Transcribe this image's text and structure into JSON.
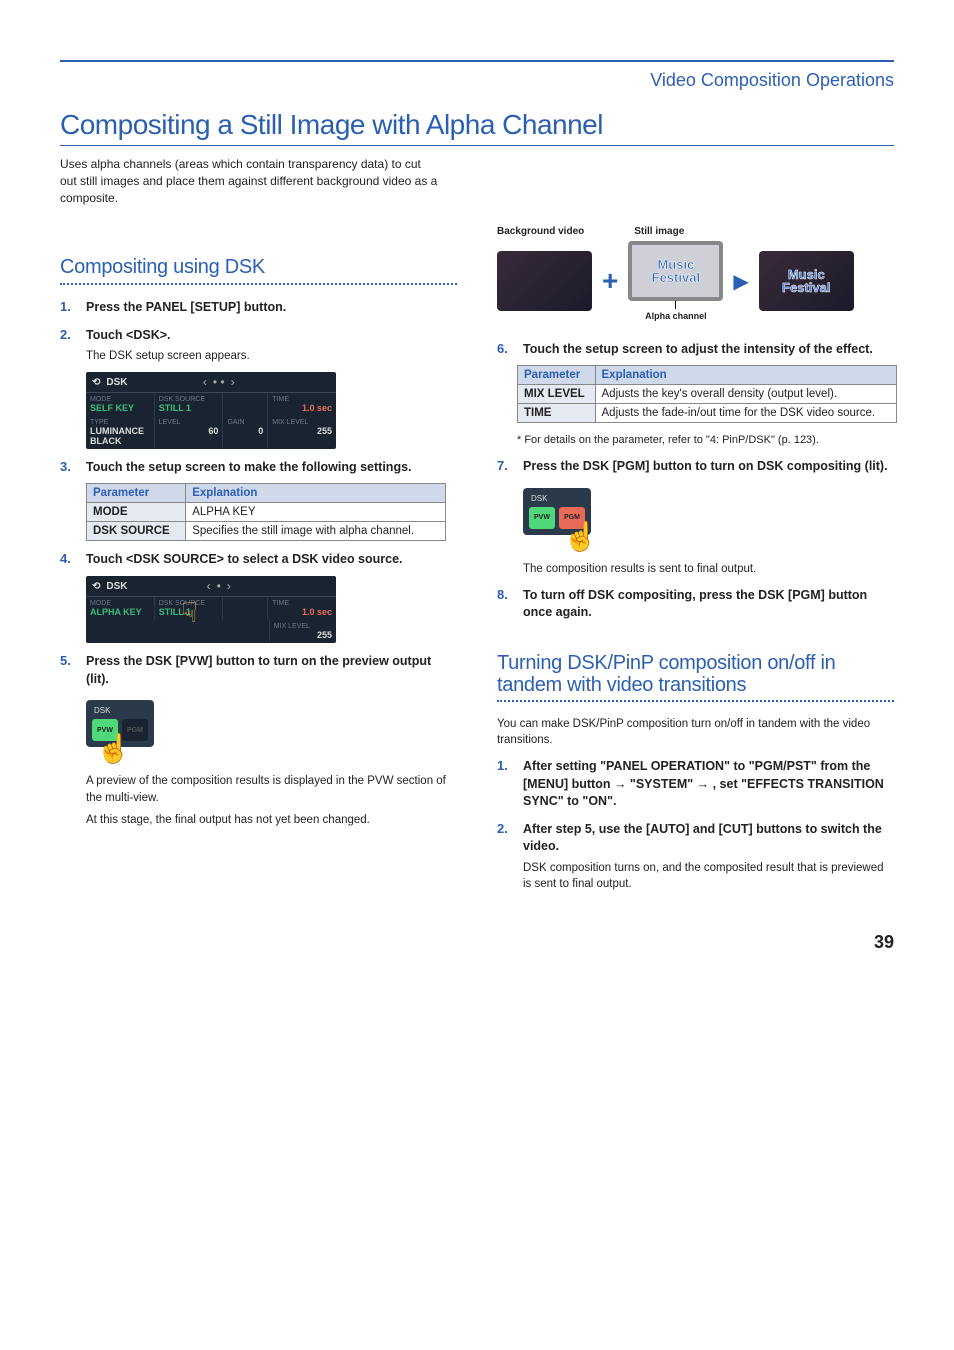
{
  "breadcrumb": "Video Composition Operations",
  "main_title": "Compositing a Still Image with Alpha Channel",
  "intro": "Uses alpha channels (areas which contain transparency data) to cut out still images and place them against different background video as a composite.",
  "diagram": {
    "bg_label": "Background video",
    "still_label": "Still image",
    "mf_line1": "Music",
    "mf_line2": "Festival",
    "alpha_label": "Alpha channel"
  },
  "section1_title": "Compositing using DSK",
  "steps_left": [
    {
      "num": "1.",
      "text": "Press the PANEL [SETUP] button."
    },
    {
      "num": "2.",
      "text": "Touch <DSK>.",
      "sub": "The DSK setup screen appears."
    },
    {
      "num": "3.",
      "text": "Touch the setup screen to make the following settings."
    },
    {
      "num": "4.",
      "text": "Touch <DSK SOURCE> to select a DSK video source."
    },
    {
      "num": "5.",
      "text": "Press the DSK [PVW] button to turn on the preview output (lit).",
      "sub1": "A preview of the composition results is displayed in the PVW section of the multi-view.",
      "sub2": "At this stage, the final output has not yet been changed."
    }
  ],
  "table_left_header": {
    "p": "Parameter",
    "e": "Explanation"
  },
  "table_left": [
    {
      "p": "MODE",
      "e": "ALPHA KEY"
    },
    {
      "p": "DSK SOURCE",
      "e": "Specifies the still image with alpha channel."
    }
  ],
  "dsk_screen1": {
    "title": "DSK",
    "mode_label": "MODE",
    "mode_val": "SELF KEY",
    "src_label": "DSK SOURCE",
    "src_val": "STILL 1",
    "time_label": "TIME",
    "time_val": "1.0 sec",
    "type_label": "TYPE",
    "type_val": "LUMINANCE",
    "level_label": "LEVEL",
    "level_val": "60",
    "gain_label": "GAIN",
    "gain_val": "0",
    "mix_label": "MIX LEVEL",
    "mix_val": "255",
    "black": "BLACK"
  },
  "dsk_screen2": {
    "title": "DSK",
    "mode_label": "MODE",
    "mode_val": "ALPHA KEY",
    "src_label": "DSK SOURCE",
    "src_val": "STILL 1",
    "time_label": "TIME",
    "time_val": "1.0 sec",
    "mix_label": "MIX LEVEL",
    "mix_val": "255"
  },
  "panel": {
    "label": "DSK",
    "pvw": "PVW",
    "pgm": "PGM"
  },
  "steps_right": [
    {
      "num": "6.",
      "text": "Touch the setup screen to adjust the intensity of the effect."
    },
    {
      "num": "7.",
      "text": "Press the DSK [PGM] button to turn on DSK compositing (lit).",
      "sub": "The composition results is sent to final output."
    },
    {
      "num": "8.",
      "text": "To turn off DSK compositing, press the DSK [PGM] button once again."
    }
  ],
  "table_right_header": {
    "p": "Parameter",
    "e": "Explanation"
  },
  "table_right": [
    {
      "p": "MIX LEVEL",
      "e": "Adjusts the key's overall density (output level)."
    },
    {
      "p": "TIME",
      "e": "Adjusts the fade-in/out time for the DSK video source."
    }
  ],
  "note_right": "*  For details on the parameter, refer to \"4: PinP/DSK\" (p. 123).",
  "section2_title": "Turning DSK/PinP composition on/off in tandem with video transitions",
  "section2_intro": "You can make DSK/PinP composition turn on/off in tandem with the video transitions.",
  "section2_steps": [
    {
      "num": "1.",
      "text": "After setting \"PANEL OPERATION\" to \"PGM/PST\" from the [MENU] button → \"SYSTEM\" → , set \"EFFECTS TRANSITION SYNC\" to \"ON\"."
    },
    {
      "num": "2.",
      "text": "After step 5, use the [AUTO] and [CUT] buttons to switch the video.",
      "sub": "DSK composition turns on, and the composited result that is previewed is sent to final output."
    }
  ],
  "page_number": "39"
}
